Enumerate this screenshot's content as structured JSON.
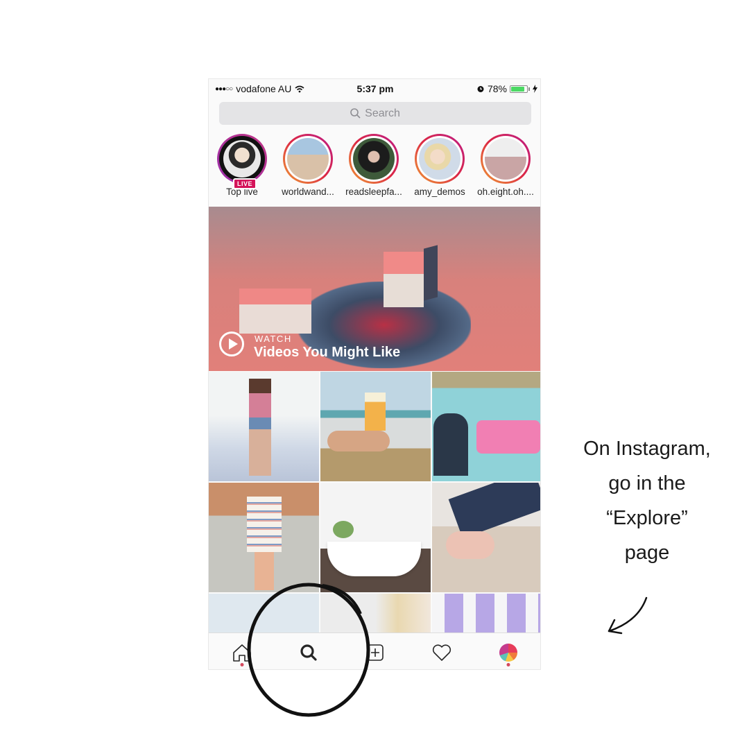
{
  "status_bar": {
    "signal": "●●●○○",
    "carrier": "vodafone AU",
    "time": "5:37 pm",
    "battery_percent": "78%",
    "battery_level": 0.78,
    "icons": [
      "signal-icon",
      "wifi-icon",
      "alarm-icon",
      "battery-icon",
      "charging-icon"
    ]
  },
  "search": {
    "placeholder": "Search"
  },
  "stories": [
    {
      "label": "Top live",
      "badge": "LIVE"
    },
    {
      "label": "worldwand..."
    },
    {
      "label": "readsleepfa..."
    },
    {
      "label": "amy_demos"
    },
    {
      "label": "oh.eight.oh...."
    }
  ],
  "video": {
    "kicker": "WATCH",
    "title": "Videos You Might Like"
  },
  "grid": {
    "tiles": [
      "woman-pink-top",
      "drink-on-beach",
      "pool-with-baby",
      "striped-dress-street",
      "bathtub-interior",
      "ballet-shoes",
      "colorful-buildings",
      "blonde-woman",
      "lavender-stripes"
    ]
  },
  "tabbar": {
    "items": [
      "home",
      "search",
      "new-post",
      "activity",
      "profile"
    ],
    "active": "search"
  },
  "annotation": {
    "lines": [
      "On Instagram,",
      "go in the",
      "“Explore”",
      "page"
    ]
  },
  "colors": {
    "live": "#d4145a",
    "battery": "#4cd964",
    "notification_dot": "#d4495e"
  }
}
